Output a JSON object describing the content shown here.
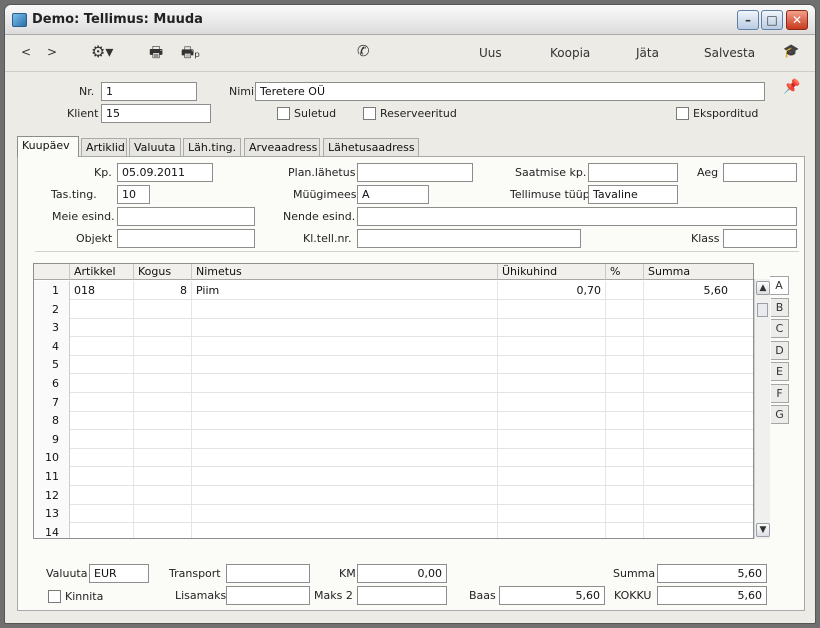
{
  "window": {
    "title": "Demo: Tellimus: Muuda"
  },
  "toolbar": {
    "prev_icon": "chevron-left-icon",
    "next_icon": "chevron-right-icon",
    "new_label": "Uus",
    "copy_label": "Koopia",
    "skip_label": "Jäta",
    "save_label": "Salvesta"
  },
  "header": {
    "nr_label": "Nr.",
    "nr_value": "1",
    "name_label": "Nimi",
    "name_value": "Teretere OÜ",
    "client_label": "Klient",
    "client_value": "15",
    "closed_label": "Suletud",
    "reserved_label": "Reserveeritud",
    "exported_label": "Eksporditud"
  },
  "tabs": [
    {
      "label": "Kuupäev"
    },
    {
      "label": "Artiklid"
    },
    {
      "label": "Valuuta"
    },
    {
      "label": "Läh.ting."
    },
    {
      "label": "Arveaadress"
    },
    {
      "label": "Lähetusaadress"
    }
  ],
  "fields": {
    "kp_label": "Kp.",
    "kp_value": "05.09.2011",
    "plan_label": "Plan.lähetus",
    "plan_value": "",
    "saatmise_label": "Saatmise kp.",
    "saatmise_value": "",
    "aeg_label": "Aeg",
    "aeg_value": "",
    "tas_label": "Tas.ting.",
    "tas_value": "10",
    "myygimees_label": "Müügimees",
    "myygimees_value": "A",
    "tyyp_label": "Tellimuse tüüp",
    "tyyp_value": "Tavaline",
    "meie_label": "Meie esind.",
    "meie_value": "",
    "nende_label": "Nende esind.",
    "nende_value": "",
    "objekt_label": "Objekt",
    "objekt_value": "",
    "kltell_label": "Kl.tell.nr.",
    "kltell_value": "",
    "klass_label": "Klass",
    "klass_value": ""
  },
  "grid": {
    "columns": [
      "Artikkel",
      "Kogus",
      "Nimetus",
      "Ühikuhind",
      "%",
      "Summa"
    ],
    "rows": [
      {
        "n": "1",
        "artikkel": "018",
        "kogus": "8",
        "nimetus": "Piim",
        "hind": "0,70",
        "pct": "",
        "summa": "5,60"
      },
      {
        "n": "2"
      },
      {
        "n": "3"
      },
      {
        "n": "4"
      },
      {
        "n": "5"
      },
      {
        "n": "6"
      },
      {
        "n": "7"
      },
      {
        "n": "8"
      },
      {
        "n": "9"
      },
      {
        "n": "10"
      },
      {
        "n": "11"
      },
      {
        "n": "12"
      },
      {
        "n": "13"
      },
      {
        "n": "14"
      }
    ],
    "letter_tabs": [
      "A",
      "B",
      "C",
      "D",
      "E",
      "F",
      "G"
    ]
  },
  "footer": {
    "valuuta_label": "Valuuta",
    "valuuta_value": "EUR",
    "kinnita_label": "Kinnita",
    "transport_label": "Transport",
    "transport_value": "",
    "lisamaks_label": "Lisamaks",
    "lisamaks_value": "",
    "km_label": "KM",
    "km_value": "0,00",
    "maks2_label": "Maks 2",
    "maks2_value": "",
    "baas_label": "Baas",
    "baas_value": "5,60",
    "summa_label": "Summa",
    "summa_value": "5,60",
    "kokku_label": "KOKKU",
    "kokku_value": "5,60"
  }
}
